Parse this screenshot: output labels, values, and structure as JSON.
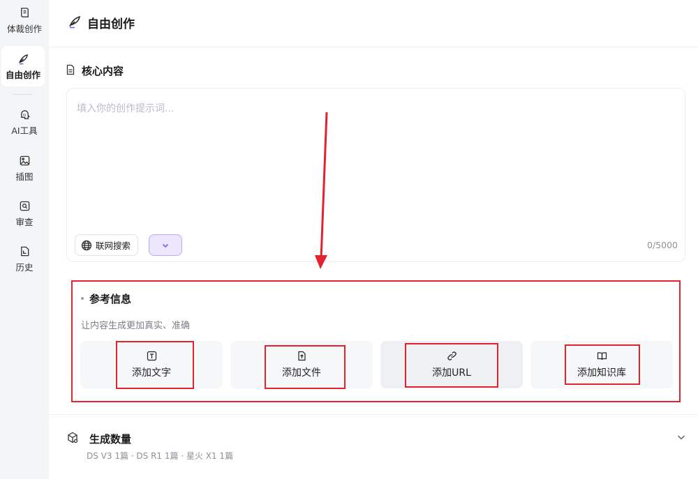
{
  "sidebar": {
    "items": [
      {
        "label": "体裁创作",
        "icon": "genre-icon"
      },
      {
        "label": "自由创作",
        "icon": "quill-icon"
      },
      {
        "label": "AI工具",
        "icon": "ai-head-icon"
      },
      {
        "label": "插图",
        "icon": "image-icon"
      },
      {
        "label": "审查",
        "icon": "review-icon"
      },
      {
        "label": "历史",
        "icon": "history-icon"
      }
    ]
  },
  "header": {
    "title": "自由创作"
  },
  "core": {
    "title": "核心内容",
    "placeholder": "填入你的创作提示词...",
    "web_search_label": "联网搜索",
    "char_count": "0/5000"
  },
  "reference": {
    "title": "参考信息",
    "subtitle": "让内容生成更加真实、准确",
    "cards": [
      {
        "label": "添加文字",
        "icon": "text-icon"
      },
      {
        "label": "添加文件",
        "icon": "upload-file-icon"
      },
      {
        "label": "添加URL",
        "icon": "link-icon"
      },
      {
        "label": "添加知识库",
        "icon": "book-icon"
      }
    ]
  },
  "generate": {
    "title": "生成数量",
    "summary": "DS V3 1篇 · DS R1 1篇 · 星火 X1 1篇"
  },
  "colors": {
    "accent": "#7b5cf0",
    "annotation_red": "#e2232d"
  }
}
